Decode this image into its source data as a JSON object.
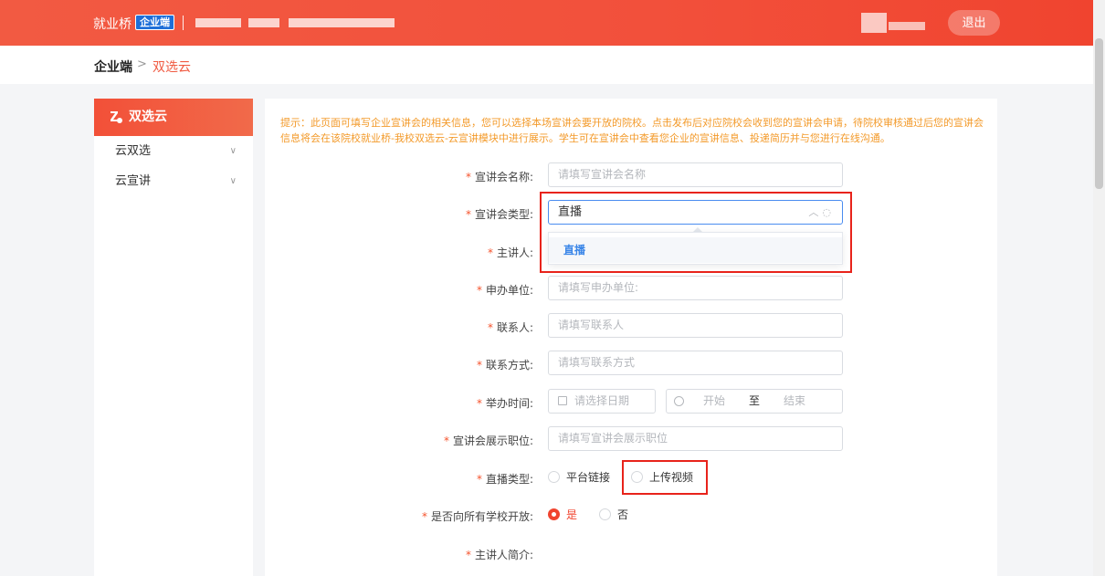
{
  "header": {
    "brand": "就业桥",
    "badge": "企业端",
    "logout_label": "退出"
  },
  "breadcrumb": {
    "root": "企业端",
    "separator": ">",
    "current": "双选云"
  },
  "sidebar": {
    "title": "双选云",
    "items": [
      {
        "label": "云双选"
      },
      {
        "label": "云宣讲"
      }
    ]
  },
  "tip": "提示：此页面可填写企业宣讲会的相关信息，您可以选择本场宣讲会要开放的院校。点击发布后对应院校会收到您的宣讲会申请，待院校审核通过后您的宣讲会信息将会在该院校就业桥-我校双选云-云宣讲模块中进行展示。学生可在宣讲会中查看您企业的宣讲信息、投递简历并与您进行在线沟通。",
  "form": {
    "required_mark": "*",
    "name": {
      "label": "宣讲会名称:",
      "placeholder": "请填写宣讲会名称"
    },
    "type": {
      "label": "宣讲会类型:",
      "value": "直播",
      "options": [
        "直播"
      ]
    },
    "speaker": {
      "label": "主讲人:"
    },
    "organizer": {
      "label": "申办单位:",
      "placeholder": "请填写申办单位:"
    },
    "contact": {
      "label": "联系人:",
      "placeholder": "请填写联系人"
    },
    "phone": {
      "label": "联系方式:",
      "placeholder": "请填写联系方式"
    },
    "time": {
      "label": "举办时间:",
      "date_placeholder": "请选择日期",
      "start": "开始",
      "to": "至",
      "end": "结束"
    },
    "position": {
      "label": "宣讲会展示职位:",
      "placeholder": "请填写宣讲会展示职位"
    },
    "live_type": {
      "label": "直播类型:",
      "options": [
        "平台链接",
        "上传视频"
      ]
    },
    "open_all": {
      "label": "是否向所有学校开放:",
      "options": [
        "是",
        "否"
      ],
      "selected": "是"
    },
    "speaker_intro": {
      "label": "主讲人简介:"
    }
  },
  "colors": {
    "accent": "#f0442f",
    "link": "#3a86e8",
    "tip": "#f39a2a",
    "highlight_box": "#e8231b"
  }
}
